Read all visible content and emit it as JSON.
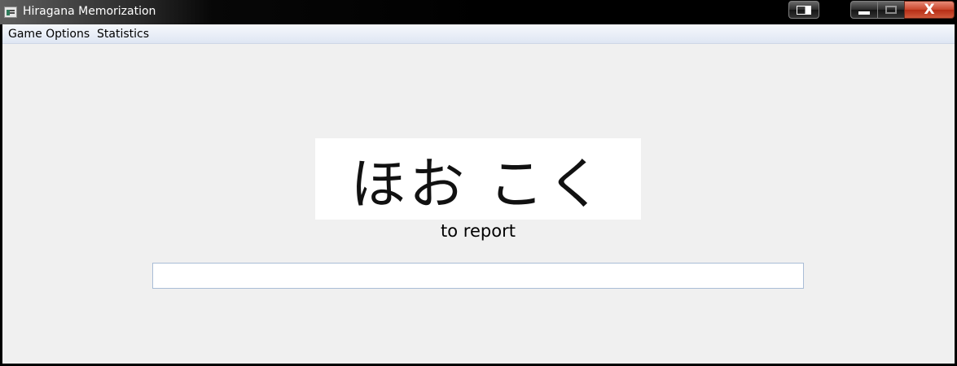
{
  "window": {
    "title": "Hiragana Memorization"
  },
  "titlebar_buttons": {
    "close_glyph": "X"
  },
  "menu": {
    "items": [
      {
        "label": "Game Options"
      },
      {
        "label": "Statistics"
      }
    ]
  },
  "main": {
    "kana": "ほお こく",
    "hint": "to report",
    "answer_value": "",
    "answer_placeholder": ""
  },
  "colors": {
    "client_background": "#f0f0f0",
    "menubar_gradient_top": "#f6f8fc",
    "close_button": "#c9452b"
  },
  "icons": [
    "app-icon",
    "pin-window-icon",
    "minimize-icon",
    "maximize-icon",
    "close-icon"
  ]
}
